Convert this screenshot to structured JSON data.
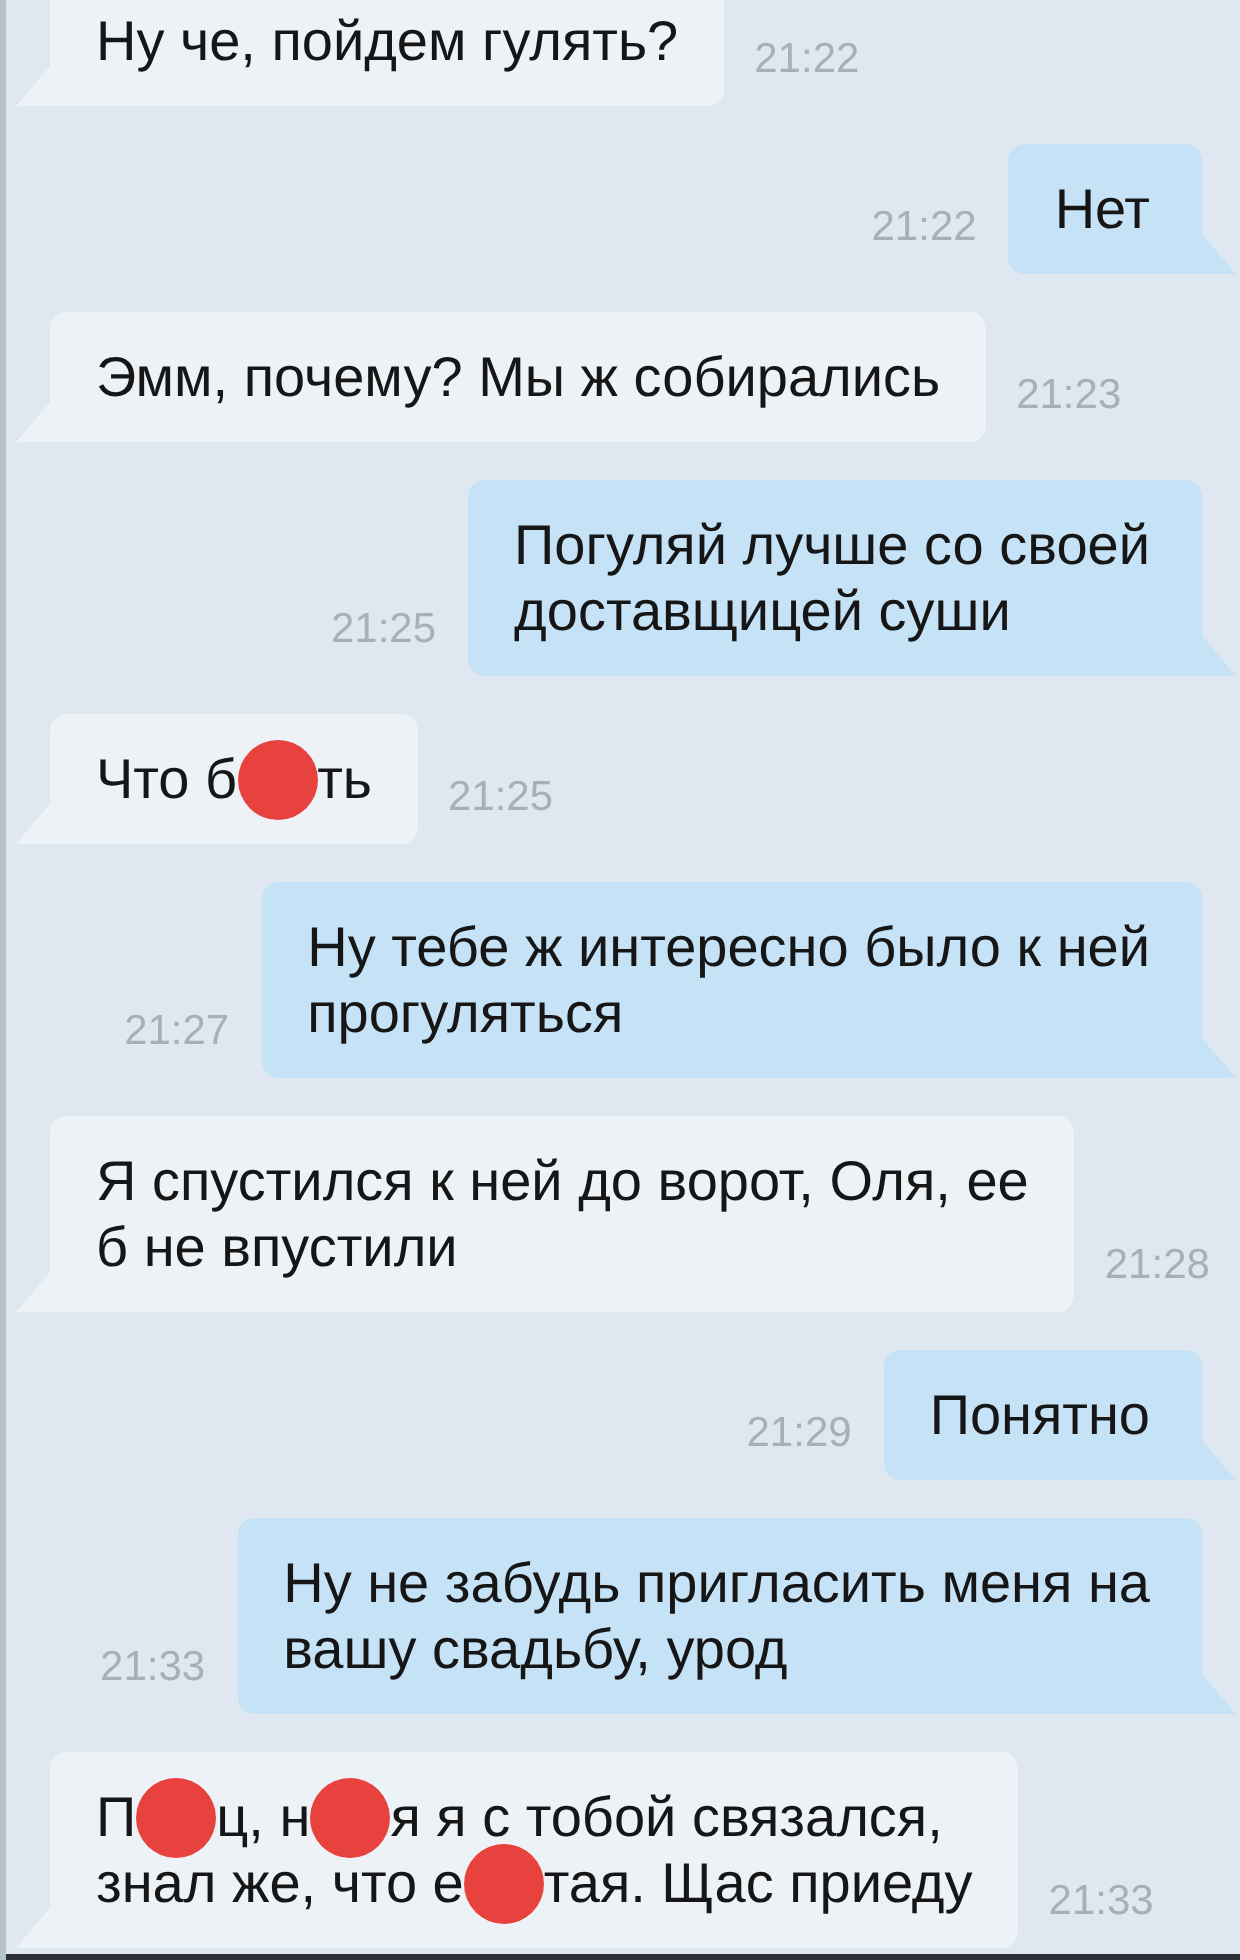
{
  "messages": [
    {
      "kind": "incoming",
      "text": "Ну че, пойдем гулять?",
      "time": "21:22"
    },
    {
      "kind": "outgoing",
      "text": "Нет",
      "time": "21:22"
    },
    {
      "kind": "incoming",
      "text": "Эмм, почему? Мы ж собирались",
      "time": "21:23"
    },
    {
      "kind": "outgoing",
      "text": "Погуляй лучше со своей\nдоставщицей суши",
      "time": "21:25"
    },
    {
      "kind": "incoming",
      "parts": [
        {
          "kind": "text",
          "text": "Что б"
        },
        {
          "kind": "blot"
        },
        {
          "kind": "text",
          "text": "ть"
        }
      ],
      "time": "21:25"
    },
    {
      "kind": "outgoing",
      "text": "Ну тебе ж интересно было к ней\nпрогуляться",
      "time": "21:27"
    },
    {
      "kind": "incoming",
      "text": "Я спустился к ней до ворот, Оля, ее\nб не впустили",
      "time": "21:28"
    },
    {
      "kind": "outgoing",
      "text": "Понятно",
      "time": "21:29"
    },
    {
      "kind": "outgoing",
      "text": "Ну не забудь пригласить меня на\nвашу свадьбу, урод",
      "time": "21:33"
    },
    {
      "kind": "incoming",
      "parts": [
        {
          "kind": "text",
          "text": "П"
        },
        {
          "kind": "blot"
        },
        {
          "kind": "text",
          "text": "ц, н"
        },
        {
          "kind": "blot"
        },
        {
          "kind": "text",
          "text": "я я с тобой связался,"
        },
        {
          "kind": "break"
        },
        {
          "kind": "text",
          "text": "знал же, что е"
        },
        {
          "kind": "blot"
        },
        {
          "kind": "text",
          "text": "тая. Щас приеду"
        }
      ],
      "time": "21:33"
    }
  ]
}
